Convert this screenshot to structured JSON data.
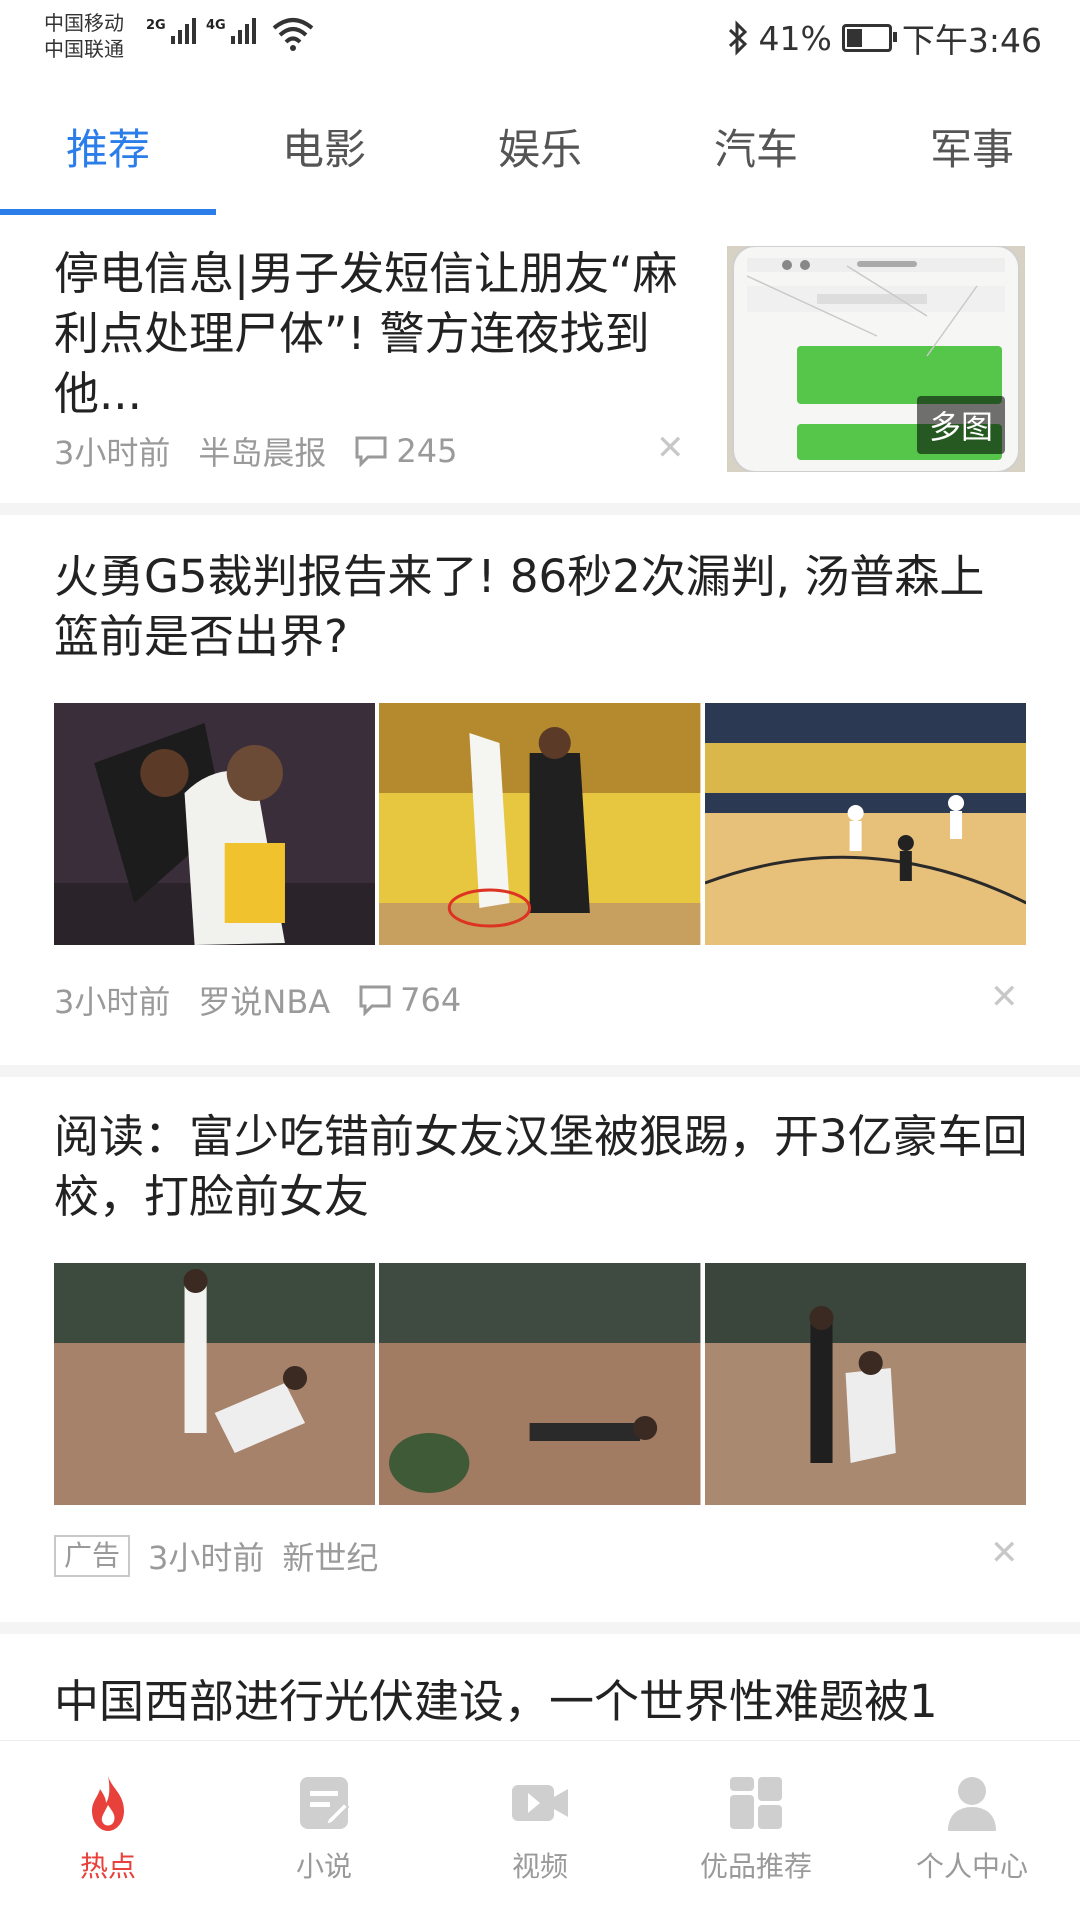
{
  "status_bar": {
    "carrier_1": "中国移动",
    "carrier_2": "中国联通",
    "signal_1_label": "2G",
    "signal_2_label": "4G",
    "battery_text": "41%",
    "battery_level": 0.41,
    "time": "下午3:46"
  },
  "tabs": [
    {
      "label": "推荐"
    },
    {
      "label": "电影"
    },
    {
      "label": "娱乐"
    },
    {
      "label": "汽车"
    },
    {
      "label": "军事"
    }
  ],
  "articles": [
    {
      "title": "停电信息|男子发短信让朋友“麻利点处理尸体”! 警方连夜找到他...",
      "time": "3小时前",
      "source": "半岛晨报",
      "comments": "245",
      "badge": "多图"
    },
    {
      "title": "火勇G5裁判报告来了! 86秒2次漏判, 汤普森上篮前是否出界?",
      "time": "3小时前",
      "source": "罗说NBA",
      "comments": "764"
    },
    {
      "title": "阅读：富少吃错前女友汉堡被狠踢，开3亿豪车回校，打脸前女友",
      "ad": "广告",
      "time": "3小时前",
      "source": "新世纪"
    },
    {
      "title": "中国西部进行光伏建设，一个世界性难题被1"
    }
  ],
  "bottom_nav": [
    {
      "label": "热点",
      "icon": "fire-icon"
    },
    {
      "label": "小说",
      "icon": "notebook-icon"
    },
    {
      "label": "视频",
      "icon": "video-camera-icon"
    },
    {
      "label": "优品推荐",
      "icon": "grid-icon"
    },
    {
      "label": "个人中心",
      "icon": "person-icon"
    }
  ],
  "colors": {
    "accent_blue": "#2b7de9",
    "active_red": "#e8413c",
    "meta_gray": "#9a9a9a"
  }
}
